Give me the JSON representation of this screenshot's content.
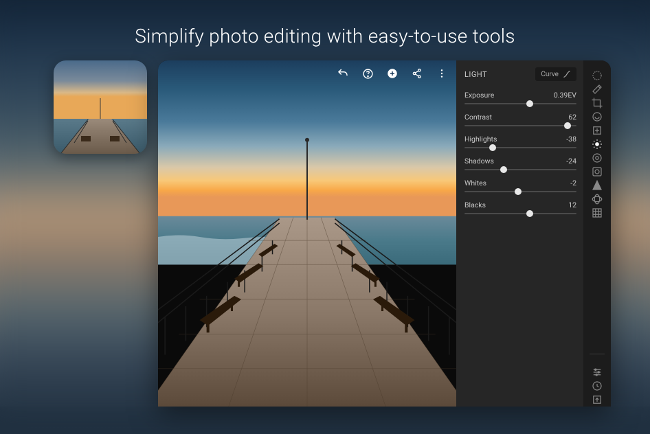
{
  "headline": "Simplify photo editing with easy-to-use tools",
  "panel": {
    "title": "LIGHT",
    "curve_label": "Curve",
    "sliders": [
      {
        "label": "Exposure",
        "value": "0.39EV",
        "pos": 58
      },
      {
        "label": "Contrast",
        "value": "62",
        "pos": 92
      },
      {
        "label": "Highlights",
        "value": "-38",
        "pos": 25
      },
      {
        "label": "Shadows",
        "value": "-24",
        "pos": 35
      },
      {
        "label": "Whites",
        "value": "-2",
        "pos": 48
      },
      {
        "label": "Blacks",
        "value": "12",
        "pos": 58
      }
    ]
  },
  "top_actions": [
    "undo",
    "help",
    "add",
    "share",
    "more"
  ],
  "tools": [
    {
      "name": "loupe",
      "active": false
    },
    {
      "name": "healing",
      "active": false
    },
    {
      "name": "crop",
      "active": false
    },
    {
      "name": "profile",
      "active": false
    },
    {
      "name": "auto",
      "active": false
    },
    {
      "name": "light",
      "active": true
    },
    {
      "name": "color",
      "active": false
    },
    {
      "name": "effects",
      "active": false
    },
    {
      "name": "detail",
      "active": false
    },
    {
      "name": "optics",
      "active": false
    },
    {
      "name": "geometry",
      "active": false
    }
  ],
  "tools_bottom": [
    {
      "name": "presets"
    },
    {
      "name": "versions"
    },
    {
      "name": "export"
    }
  ]
}
